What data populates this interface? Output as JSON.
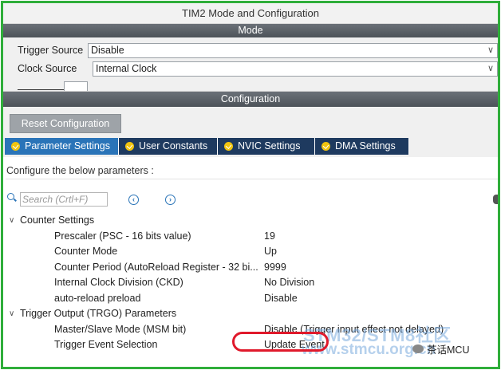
{
  "window": {
    "title": "TIM2 Mode and Configuration"
  },
  "mode": {
    "bar_label": "Mode",
    "trigger_source": {
      "label": "Trigger Source",
      "value": "Disable"
    },
    "clock_source": {
      "label": "Clock Source",
      "value": "Internal Clock"
    }
  },
  "configuration": {
    "bar_label": "Configuration",
    "reset_label": "Reset Configuration",
    "tabs": [
      {
        "label": "Parameter Settings",
        "active": true
      },
      {
        "label": "User Constants",
        "active": false
      },
      {
        "label": "NVIC Settings",
        "active": false
      },
      {
        "label": "DMA Settings",
        "active": false
      }
    ],
    "hint": "Configure the below parameters :",
    "search_placeholder": "Search (Crtl+F)"
  },
  "groups": {
    "counter": {
      "label": "Counter Settings",
      "params": [
        {
          "name": "Prescaler (PSC - 16 bits value)",
          "value": "19"
        },
        {
          "name": "Counter Mode",
          "value": "Up"
        },
        {
          "name": "Counter Period (AutoReload Register - 32 bi...",
          "value": "9999"
        },
        {
          "name": "Internal Clock Division (CKD)",
          "value": "No Division"
        },
        {
          "name": "auto-reload preload",
          "value": "Disable"
        }
      ]
    },
    "trgo": {
      "label": "Trigger Output (TRGO) Parameters",
      "params": [
        {
          "name": "Master/Slave Mode (MSM bit)",
          "value": "Disable (Trigger input effect not delayed)"
        },
        {
          "name": "Trigger Event Selection",
          "value": "Update Event"
        }
      ]
    }
  },
  "watermark": {
    "line1": "STM32/STM8社区",
    "line2": "www.stmcu.org.cn",
    "wechat": "茶话MCU"
  },
  "colors": {
    "accent": "#2a74b8",
    "tab_bg": "#1e3a5f",
    "frame": "#2fae3a",
    "highlight": "#e0192b"
  }
}
